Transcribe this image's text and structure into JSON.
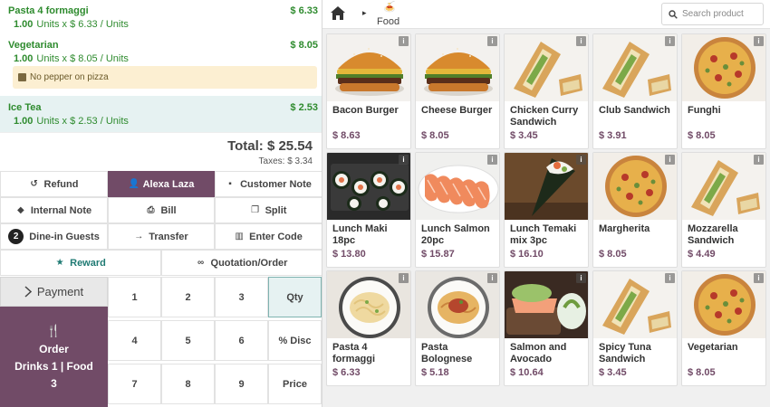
{
  "orderlines": [
    {
      "name": "Pasta 4 formaggi",
      "price": "$ 6.33",
      "qty": "1.00",
      "detail": "Units x $ 6.33 / Units"
    },
    {
      "name": "Vegetarian",
      "price": "$ 8.05",
      "qty": "1.00",
      "detail": "Units x $ 8.05 / Units",
      "note": "No pepper on pizza"
    },
    {
      "name": "Ice Tea",
      "price": "$ 2.53",
      "qty": "1.00",
      "detail": "Units x $ 2.53 / Units",
      "selected": true
    }
  ],
  "summary": {
    "total": "Total: $ 25.54",
    "taxes": "Taxes: $ 3.34"
  },
  "controls": {
    "refund": "Refund",
    "customer": "Alexa Laza",
    "customer_note": "Customer Note",
    "internal_note": "Internal Note",
    "bill": "Bill",
    "split": "Split",
    "guests_count": "2",
    "guests": "Dine-in Guests",
    "transfer": "Transfer",
    "enter_code": "Enter Code",
    "reward": "Reward",
    "quotation": "Quotation/Order"
  },
  "payment": {
    "label": "Payment"
  },
  "order_button": {
    "line1": "Order",
    "line2": "Drinks 1 | Food",
    "line3": "3"
  },
  "numpad": {
    "keys": [
      "1",
      "2",
      "3",
      "Qty",
      "4",
      "5",
      "6",
      "% Disc",
      "7",
      "8",
      "9",
      "Price"
    ],
    "active": "Qty"
  },
  "topbar": {
    "breadcrumb": "Food",
    "search_placeholder": "Search product"
  },
  "products": [
    {
      "name": "Bacon Burger",
      "price": "$ 8.63",
      "img": "burger"
    },
    {
      "name": "Cheese Burger",
      "price": "$ 8.05",
      "img": "burger"
    },
    {
      "name": "Chicken Curry Sandwich",
      "price": "$ 3.45",
      "img": "sandwich"
    },
    {
      "name": "Club Sandwich",
      "price": "$ 3.91",
      "img": "sandwich"
    },
    {
      "name": "Funghi",
      "price": "$ 8.05",
      "img": "pizza"
    },
    {
      "name": "Lunch Maki 18pc",
      "price": "$ 13.80",
      "img": "maki"
    },
    {
      "name": "Lunch Salmon 20pc",
      "price": "$ 15.87",
      "img": "salmon"
    },
    {
      "name": "Lunch Temaki mix 3pc",
      "price": "$ 16.10",
      "img": "temaki"
    },
    {
      "name": "Margherita",
      "price": "$ 8.05",
      "img": "pizza"
    },
    {
      "name": "Mozzarella Sandwich",
      "price": "$ 4.49",
      "img": "sandwich"
    },
    {
      "name": "Pasta 4 formaggi",
      "price": "$ 6.33",
      "img": "pasta"
    },
    {
      "name": "Pasta Bolognese",
      "price": "$ 5.18",
      "img": "bolognese"
    },
    {
      "name": "Salmon and Avocado",
      "price": "$ 10.64",
      "img": "avocado"
    },
    {
      "name": "Spicy Tuna Sandwich",
      "price": "$ 3.45",
      "img": "sandwich"
    },
    {
      "name": "Vegetarian",
      "price": "$ 8.05",
      "img": "pizza"
    }
  ],
  "colors": {
    "brand": "#714b67",
    "orderline_green": "#2e8b2e",
    "note_bg": "#fcefd2",
    "selected_bg": "#e6f2f2"
  }
}
